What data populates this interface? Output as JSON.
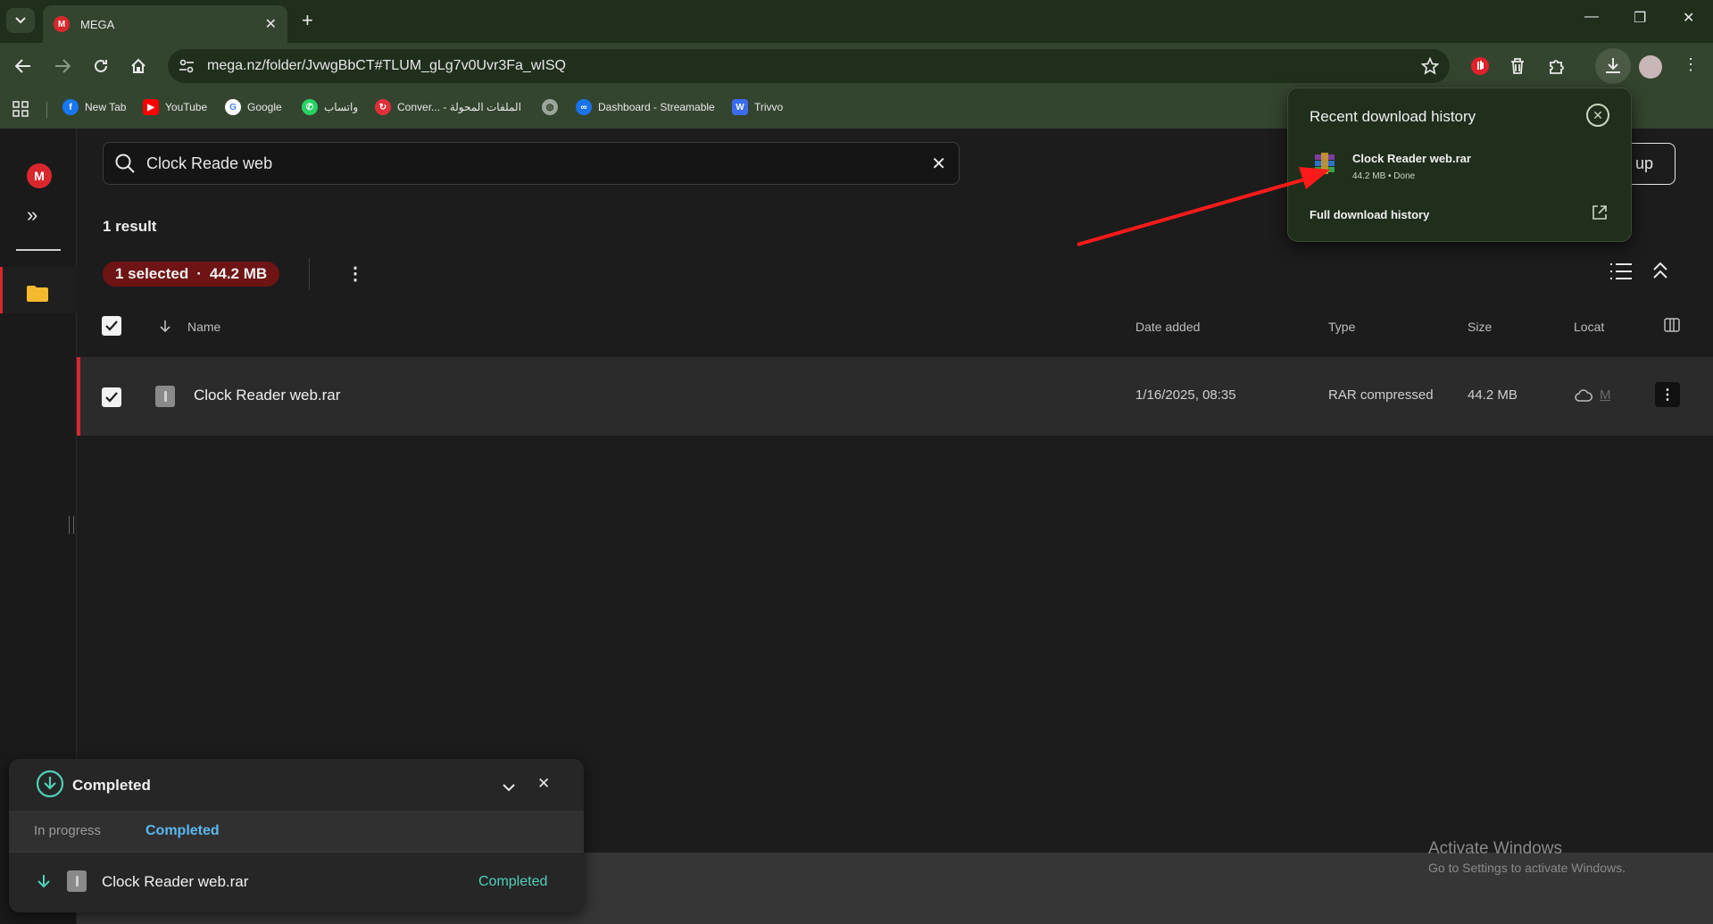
{
  "browser": {
    "tab_title": "MEGA",
    "url": "mega.nz/folder/JvwgBbCT#TLUM_gLg7v0Uvr3Fa_wISQ",
    "bookmarks": [
      {
        "label": "New Tab",
        "icon": "facebook-icon",
        "color": "#1877f2"
      },
      {
        "label": "YouTube",
        "icon": "youtube-icon",
        "color": "#ff0000"
      },
      {
        "label": "Google",
        "icon": "google-icon",
        "color": "#ffffff"
      },
      {
        "label": "واتساب",
        "icon": "whatsapp-icon",
        "color": "#25d366"
      },
      {
        "label": "Conver... - الملفات المحولة",
        "icon": "convert-icon",
        "color": "#e0303a"
      },
      {
        "label": "",
        "icon": "globe-icon",
        "color": "#9aa69a"
      },
      {
        "label": "Dashboard - Streamable",
        "icon": "streamable-icon",
        "color": "#1a73e8"
      },
      {
        "label": "Trivvo",
        "icon": "trivvo-icon",
        "color": "#3b6cf0"
      }
    ]
  },
  "app": {
    "search_value": "Clock Reade web",
    "upload_label_partial": "up",
    "result_count": "1 result",
    "selection": {
      "count_label": "1 selected",
      "separator": "·",
      "size_label": "44.2 MB"
    },
    "columns": {
      "name": "Name",
      "date": "Date added",
      "type": "Type",
      "size": "Size",
      "location": "Locat"
    },
    "rows": [
      {
        "name": "Clock Reader web.rar",
        "date": "1/16/2025, 08:35",
        "type": "RAR compressed",
        "size": "44.2 MB",
        "location": "M"
      }
    ]
  },
  "transfer_manager": {
    "title": "Completed",
    "tabs": [
      "In progress",
      "Completed"
    ],
    "active_tab": "Completed",
    "items": [
      {
        "name": "Clock Reader web.rar",
        "status": "Completed"
      }
    ],
    "accent": "#4fd1b6",
    "tab_accent": "#5ab8f0"
  },
  "download_bubble": {
    "title": "Recent download history",
    "file_name": "Clock Reader web.rar",
    "file_meta": "44.2 MB • Done",
    "full_history": "Full download history"
  },
  "watermark": {
    "line1": "Activate Windows",
    "line2": "Go to Settings to activate Windows."
  },
  "colors": {
    "mega_red": "#d9272e",
    "chrome_green": "#34452f",
    "annotation_arrow": "#ff1a1a"
  }
}
